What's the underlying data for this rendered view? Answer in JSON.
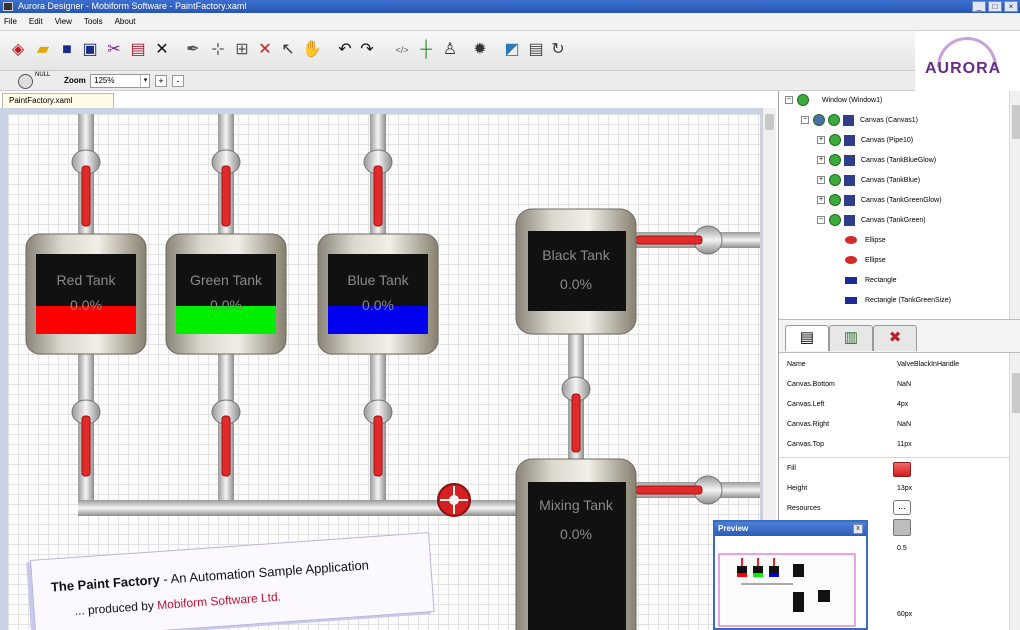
{
  "window": {
    "title": "Aurora Designer - Mobiform Software - PaintFactory.xaml"
  },
  "menu": [
    "File",
    "Edit",
    "View",
    "Tools",
    "About"
  ],
  "logo": {
    "text": "AURORA"
  },
  "zoombar": {
    "null_label": "NULL",
    "zoom_label": "Zoom",
    "zoom_value": "125%",
    "zoom_in": "+",
    "zoom_out": "-"
  },
  "document_tab": "PaintFactory.xaml",
  "canvas": {
    "tanks": [
      {
        "name": "Red Tank",
        "percent": "0.0%",
        "fill_color": "#ff0000",
        "level": 0.35
      },
      {
        "name": "Green Tank",
        "percent": "0.0%",
        "fill_color": "#00ee00",
        "level": 0.35
      },
      {
        "name": "Blue Tank",
        "percent": "0.0%",
        "fill_color": "#0000ee",
        "level": 0.35
      },
      {
        "name": "Black Tank",
        "percent": "0.0%",
        "fill_color": "#000000",
        "level": 0
      },
      {
        "name": "Mixing Tank",
        "percent": "0.0%",
        "fill_color": "#000000",
        "level": 0
      }
    ],
    "info": {
      "title": "The Paint Factory",
      "subtitle": " - An Automation Sample Application",
      "produced_prefix": "... produced by ",
      "company": "Mobiform Software Ltd."
    }
  },
  "tree": {
    "items": [
      {
        "label": "Window (Window1)",
        "kind": "window"
      },
      {
        "label": "Canvas (Canvas1)",
        "kind": "canvas"
      },
      {
        "label": "Canvas (Pipe10)",
        "kind": "canvas"
      },
      {
        "label": "Canvas (TankBlueGlow)",
        "kind": "canvas"
      },
      {
        "label": "Canvas (TankBlue)",
        "kind": "canvas"
      },
      {
        "label": "Canvas (TankGreenGlow)",
        "kind": "canvas"
      },
      {
        "label": "Canvas (TankGreen)",
        "kind": "canvas"
      },
      {
        "label": "Ellipse",
        "kind": "ellipse"
      },
      {
        "label": "Ellipse",
        "kind": "ellipse"
      },
      {
        "label": "Rectangle",
        "kind": "rectangle"
      },
      {
        "label": "Rectangle (TankGreenSize)",
        "kind": "rectangle"
      }
    ]
  },
  "properties": {
    "rows": [
      {
        "name": "Name",
        "value": "ValveBlackInHandle"
      },
      {
        "name": "Canvas.Bottom",
        "value": "NaN"
      },
      {
        "name": "Canvas.Left",
        "value": "4px"
      },
      {
        "name": "Canvas.Right",
        "value": "NaN"
      },
      {
        "name": "Canvas.Top",
        "value": "11px"
      },
      {
        "name": "Fill",
        "value": ""
      },
      {
        "name": "Height",
        "value": "13px"
      },
      {
        "name": "Resources",
        "value": "..."
      },
      {
        "name": "",
        "value": ""
      },
      {
        "name": "",
        "value": "0.5"
      }
    ],
    "bottom_value": "60px"
  },
  "preview": {
    "title": "Preview",
    "close": "x"
  }
}
